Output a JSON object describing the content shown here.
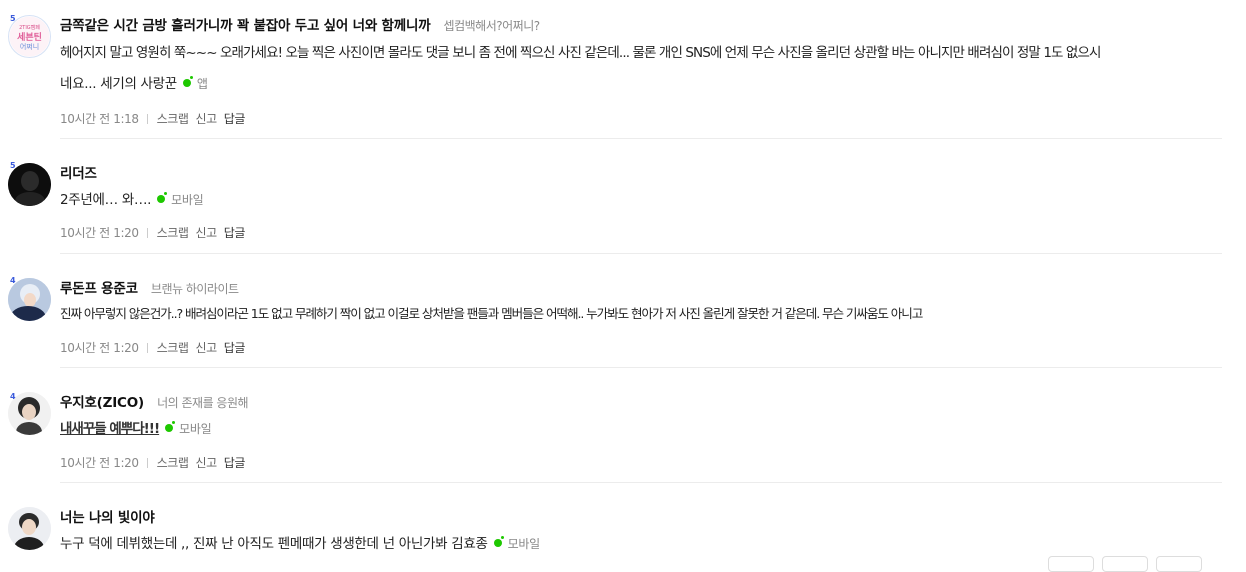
{
  "comments": [
    {
      "nickname": "금쪽같은 시간 금방 흘러가니까 꽉 붙잡아 두고 싶어 너와 함께니까",
      "note": "셉컴백해서?어쩌니?",
      "avatar_badge": "5",
      "avatar_text_top": "2TIG캠페",
      "avatar_text_mid": "세븐틴",
      "avatar_text_bot": "어쩌니",
      "text_line1": "헤어지지 말고 영원히 쭉~~~ 오래가세요! 오늘 찍은 사진이면 몰라도 댓글 보니 좀 전에 찍으신 사진 같은데... 물론 개인 SNS에 언제 무슨 사진을 올리던 상관할 바는 아니지만 배려심이 정말 1도 없으시",
      "text_line2": "네요... 세기의 사랑꾼",
      "device": "앱",
      "time": "10시간 전 1:18",
      "scrap": "스크랩",
      "report": "신고",
      "reply": "답글"
    },
    {
      "nickname": "리더즈",
      "note": "",
      "avatar_badge": "5",
      "text_line1": "2주년에… 와….",
      "device": "모바일",
      "time": "10시간 전 1:20",
      "scrap": "스크랩",
      "report": "신고",
      "reply": "답글"
    },
    {
      "nickname": "루돈프 용준코",
      "note": "브랜뉴 하이라이트",
      "avatar_badge": "4",
      "text_line1": "진짜 아무렇지 않은건가..? 배려심이라곤 1도 없고 무례하기 짝이 없고 이걸로 상처받을 팬들과 멤버들은 어떡해.. 누가봐도 현아가 저 사진 올린게 잘못한 거 같은데. 무슨 기싸움도 아니고",
      "device": "",
      "time": "10시간 전 1:20",
      "scrap": "스크랩",
      "report": "신고",
      "reply": "답글"
    },
    {
      "nickname": "우지호(ZICO)",
      "note": "너의 존재를 응원해",
      "avatar_badge": "4",
      "text_line1": "내새꾸들 예뿌다!!!",
      "device": "모바일",
      "time": "10시간 전 1:20",
      "scrap": "스크랩",
      "report": "신고",
      "reply": "답글"
    },
    {
      "nickname": "너는 나의 빛이야",
      "note": "",
      "avatar_badge": "",
      "text_line1": "누구 덕에 데뷔했는데 ,, 진짜 난 아직도 펜메때가 생생한데 넌 아닌가봐 김효종",
      "device": "모바일"
    }
  ],
  "colors": {
    "online_dot": "#1ec800",
    "badge": "#3b5bdb",
    "divider": "#ececec"
  }
}
